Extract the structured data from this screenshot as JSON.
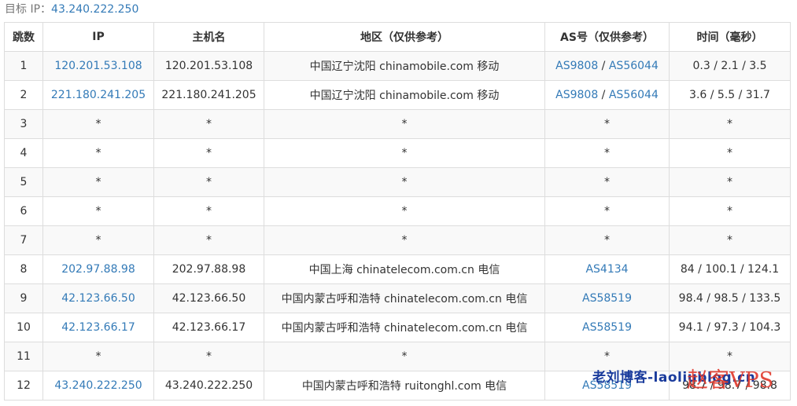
{
  "target": {
    "label": "目标 IP：",
    "ip": "43.240.222.250"
  },
  "headers": [
    "跳数",
    "IP",
    "主机名",
    "地区（仅供参考）",
    "AS号（仅供参考）",
    "时间（毫秒）"
  ],
  "rows": [
    {
      "hop": "1",
      "ip": "120.201.53.108",
      "host": "120.201.53.108",
      "region": "中国辽宁沈阳 chinamobile.com 移动",
      "as": [
        "AS9808",
        "AS56044"
      ],
      "time": "0.3 / 2.1 / 3.5"
    },
    {
      "hop": "2",
      "ip": "221.180.241.205",
      "host": "221.180.241.205",
      "region": "中国辽宁沈阳 chinamobile.com 移动",
      "as": [
        "AS9808",
        "AS56044"
      ],
      "time": "3.6 / 5.5 / 31.7"
    },
    {
      "hop": "3",
      "ip": "*",
      "host": "*",
      "region": "*",
      "as": [
        "*"
      ],
      "time": "*"
    },
    {
      "hop": "4",
      "ip": "*",
      "host": "*",
      "region": "*",
      "as": [
        "*"
      ],
      "time": "*"
    },
    {
      "hop": "5",
      "ip": "*",
      "host": "*",
      "region": "*",
      "as": [
        "*"
      ],
      "time": "*"
    },
    {
      "hop": "6",
      "ip": "*",
      "host": "*",
      "region": "*",
      "as": [
        "*"
      ],
      "time": "*"
    },
    {
      "hop": "7",
      "ip": "*",
      "host": "*",
      "region": "*",
      "as": [
        "*"
      ],
      "time": "*"
    },
    {
      "hop": "8",
      "ip": "202.97.88.98",
      "host": "202.97.88.98",
      "region": "中国上海 chinatelecom.com.cn 电信",
      "as": [
        "AS4134"
      ],
      "time": "84 / 100.1 / 124.1"
    },
    {
      "hop": "9",
      "ip": "42.123.66.50",
      "host": "42.123.66.50",
      "region": "中国内蒙古呼和浩特 chinatelecom.com.cn 电信",
      "as": [
        "AS58519"
      ],
      "time": "98.4 / 98.5 / 133.5"
    },
    {
      "hop": "10",
      "ip": "42.123.66.17",
      "host": "42.123.66.17",
      "region": "中国内蒙古呼和浩特 chinatelecom.com.cn 电信",
      "as": [
        "AS58519"
      ],
      "time": "94.1 / 97.3 / 104.3"
    },
    {
      "hop": "11",
      "ip": "*",
      "host": "*",
      "region": "*",
      "as": [
        "*"
      ],
      "time": "*"
    },
    {
      "hop": "12",
      "ip": "43.240.222.250",
      "host": "43.240.222.250",
      "region": "中国内蒙古呼和浩特 ruitonghl.com 电信",
      "as": [
        "AS58519"
      ],
      "time": "98.7 / 98.7 / 98.8"
    }
  ],
  "watermark": {
    "text1": "老刘博客-laoliublog.cn",
    "text2": "赵客VPS"
  },
  "colors": {
    "link": "#337ab7",
    "border": "#dddddd",
    "stripe": "#f9f9f9"
  }
}
